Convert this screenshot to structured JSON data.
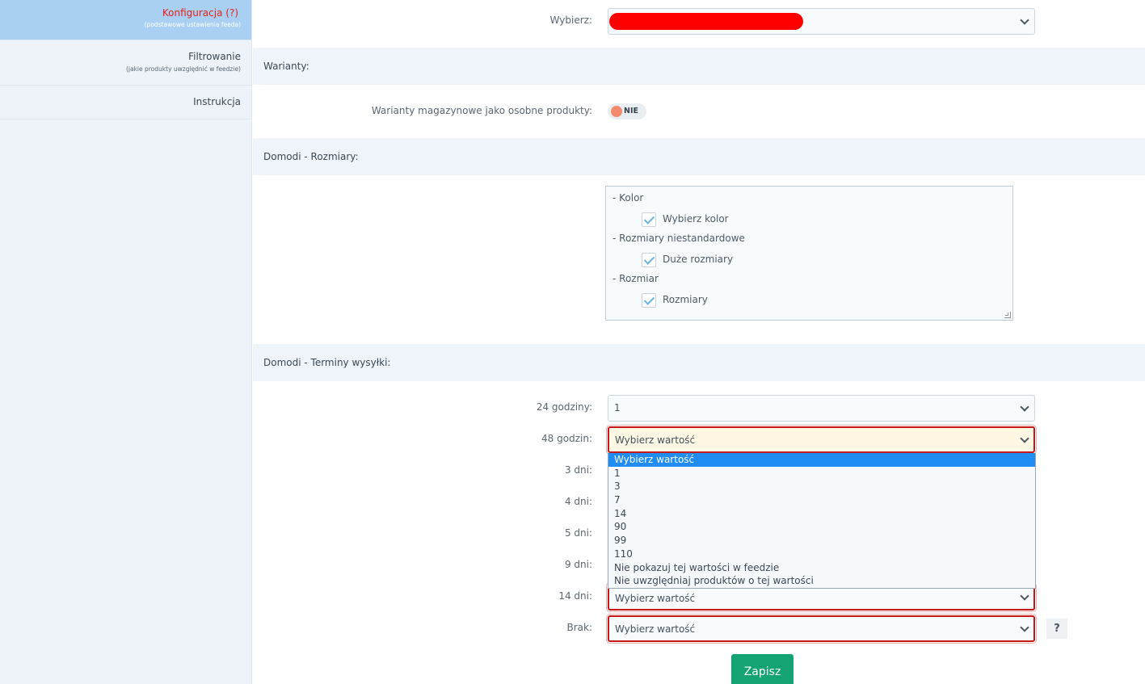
{
  "sidebar": {
    "items": [
      {
        "label": "Konfiguracja (?)",
        "sublabel": "(podstawowe ustawienia feeda)",
        "active": true
      },
      {
        "label": "Filtrowanie",
        "sublabel": "(jakie produkty uwzględnić w feedzie)",
        "active": false
      },
      {
        "label": "Instrukcja",
        "sublabel": "",
        "active": false
      }
    ]
  },
  "top": {
    "label": "Wybierz:",
    "value": ""
  },
  "variants": {
    "title": "Warianty:",
    "label": "Warianty magazynowe jako osobne produkty:",
    "toggle_text": "NIE"
  },
  "sizes": {
    "title": "Domodi - Rozmiary:",
    "groups": [
      {
        "group": "- Kolor",
        "option": "Wybierz kolor"
      },
      {
        "group": "- Rozmiary niestandardowe",
        "option": "Duże rozmiary"
      },
      {
        "group": "- Rozmiar",
        "option": "Rozmiary"
      }
    ]
  },
  "shipping": {
    "title": "Domodi - Terminy wysyłki:",
    "rows": [
      {
        "label": "24 godziny:",
        "value": "1"
      },
      {
        "label": "48 godzin:",
        "value": "Wybierz wartość"
      },
      {
        "label": "3 dni:",
        "value": ""
      },
      {
        "label": "4 dni:",
        "value": ""
      },
      {
        "label": "5 dni:",
        "value": ""
      },
      {
        "label": "9 dni:",
        "value": ""
      },
      {
        "label": "14 dni:",
        "value": "Wybierz wartość"
      },
      {
        "label": "Brak:",
        "value": "Wybierz wartość"
      }
    ],
    "dropdown_options": [
      "Wybierz wartość",
      "1",
      "3",
      "7",
      "14",
      "90",
      "99",
      "110",
      "Nie pokazuj tej wartości w feedzie",
      "Nie uwzględniaj produktów o tej wartości"
    ],
    "help": "?"
  },
  "save_label": "Zapisz",
  "colors": {
    "accent_red": "#e8201b",
    "active_nav": "#a9d0f3",
    "save_green": "#14a372",
    "option_selected": "#1f8df3"
  }
}
